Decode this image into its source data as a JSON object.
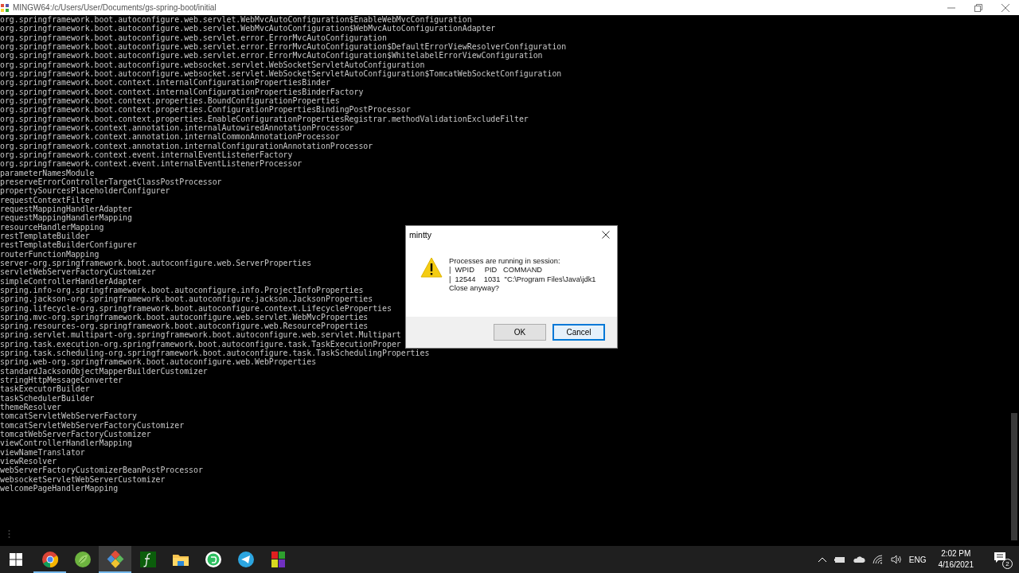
{
  "window": {
    "title": "MINGW64:/c/Users/User/Documents/gs-spring-boot/initial"
  },
  "terminal": {
    "lines": [
      "org.springframework.boot.autoconfigure.web.servlet.WebMvcAutoConfiguration$EnableWebMvcConfiguration",
      "org.springframework.boot.autoconfigure.web.servlet.WebMvcAutoConfiguration$WebMvcAutoConfigurationAdapter",
      "org.springframework.boot.autoconfigure.web.servlet.error.ErrorMvcAutoConfiguration",
      "org.springframework.boot.autoconfigure.web.servlet.error.ErrorMvcAutoConfiguration$DefaultErrorViewResolverConfiguration",
      "org.springframework.boot.autoconfigure.web.servlet.error.ErrorMvcAutoConfiguration$WhitelabelErrorViewConfiguration",
      "org.springframework.boot.autoconfigure.websocket.servlet.WebSocketServletAutoConfiguration",
      "org.springframework.boot.autoconfigure.websocket.servlet.WebSocketServletAutoConfiguration$TomcatWebSocketConfiguration",
      "org.springframework.boot.context.internalConfigurationPropertiesBinder",
      "org.springframework.boot.context.internalConfigurationPropertiesBinderFactory",
      "org.springframework.boot.context.properties.BoundConfigurationProperties",
      "org.springframework.boot.context.properties.ConfigurationPropertiesBindingPostProcessor",
      "org.springframework.boot.context.properties.EnableConfigurationPropertiesRegistrar.methodValidationExcludeFilter",
      "org.springframework.context.annotation.internalAutowiredAnnotationProcessor",
      "org.springframework.context.annotation.internalCommonAnnotationProcessor",
      "org.springframework.context.annotation.internalConfigurationAnnotationProcessor",
      "org.springframework.context.event.internalEventListenerFactory",
      "org.springframework.context.event.internalEventListenerProcessor",
      "parameterNamesModule",
      "preserveErrorControllerTargetClassPostProcessor",
      "propertySourcesPlaceholderConfigurer",
      "requestContextFilter",
      "requestMappingHandlerAdapter",
      "requestMappingHandlerMapping",
      "resourceHandlerMapping",
      "restTemplateBuilder",
      "restTemplateBuilderConfigurer",
      "routerFunctionMapping",
      "server-org.springframework.boot.autoconfigure.web.ServerProperties",
      "servletWebServerFactoryCustomizer",
      "simpleControllerHandlerAdapter",
      "spring.info-org.springframework.boot.autoconfigure.info.ProjectInfoProperties",
      "spring.jackson-org.springframework.boot.autoconfigure.jackson.JacksonProperties",
      "spring.lifecycle-org.springframework.boot.autoconfigure.context.LifecycleProperties",
      "spring.mvc-org.springframework.boot.autoconfigure.web.servlet.WebMvcProperties",
      "spring.resources-org.springframework.boot.autoconfigure.web.ResourceProperties",
      "spring.servlet.multipart-org.springframework.boot.autoconfigure.web.servlet.Multipart",
      "spring.task.execution-org.springframework.boot.autoconfigure.task.TaskExecutionProper",
      "spring.task.scheduling-org.springframework.boot.autoconfigure.task.TaskSchedulingProperties",
      "spring.web-org.springframework.boot.autoconfigure.web.WebProperties",
      "standardJacksonObjectMapperBuilderCustomizer",
      "stringHttpMessageConverter",
      "taskExecutorBuilder",
      "taskSchedulerBuilder",
      "themeResolver",
      "tomcatServletWebServerFactory",
      "tomcatServletWebServerFactoryCustomizer",
      "tomcatWebServerFactoryCustomizer",
      "viewControllerHandlerMapping",
      "viewNameTranslator",
      "viewResolver",
      "webServerFactoryCustomizerBeanPostProcessor",
      "websocketServletWebServerCustomizer",
      "welcomePageHandlerMapping"
    ]
  },
  "dialog": {
    "title": "mintty",
    "message": [
      "Processes are running in session:",
      "|  WPID     PID   COMMAND",
      "|  12544    1031  \"C:\\Program Files\\Java\\jdk1",
      "Close anyway?"
    ],
    "buttons": [
      {
        "label": "OK",
        "selected": false
      },
      {
        "label": "Cancel",
        "selected": true
      }
    ]
  },
  "taskbar": {
    "apps": [
      {
        "running": true,
        "selected": false
      },
      {
        "running": false,
        "selected": false
      },
      {
        "running": true,
        "selected": true
      },
      {
        "running": false,
        "selected": false
      },
      {
        "running": false,
        "selected": false
      },
      {
        "running": false,
        "selected": false
      },
      {
        "running": false,
        "selected": false
      },
      {
        "running": false,
        "selected": false
      }
    ],
    "language": "ENG",
    "time": "2:02 PM",
    "date": "4/16/2021",
    "notification_count": "2"
  }
}
